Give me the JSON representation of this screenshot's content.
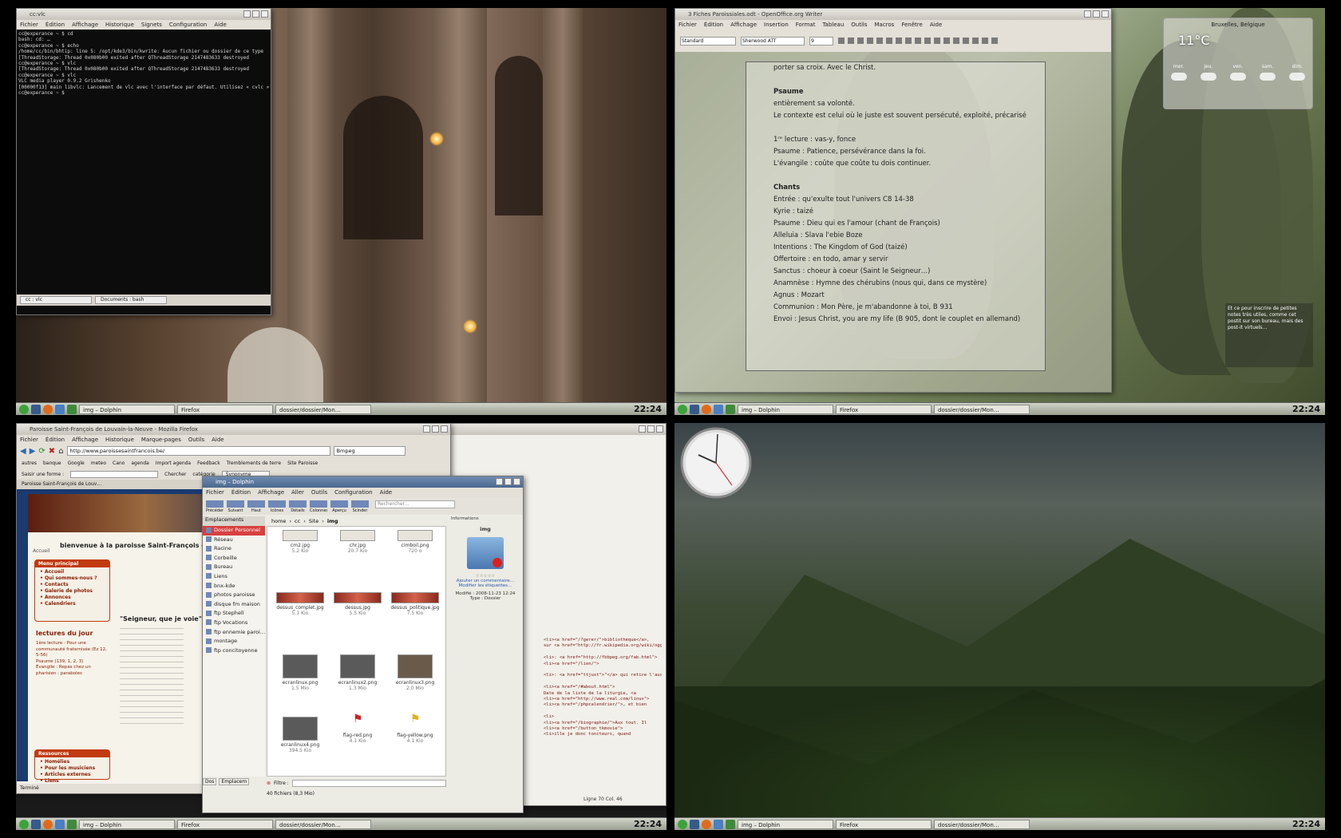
{
  "time": "22:24",
  "taskbar": {
    "tasks": [
      "img – Dolphin",
      "Firefox",
      "dossier/dossier/Mon…"
    ]
  },
  "q1": {
    "terminal": {
      "title": "cc:vlc",
      "menu": [
        "Fichier",
        "Édition",
        "Affichage",
        "Historique",
        "Signets",
        "Configuration",
        "Aide"
      ],
      "lines": [
        "cc@experance ~ $ cd",
        "bash: cd: …",
        "cc@experance ~ $ echo",
        "/home/cc/bin/bhtip: line 5: /opt/kde3/bin/kwrite: Aucun fichier ou dossier de ce type",
        "[ThreadStorage: Thread 0x080b00 exited after QThreadStorage 2147483633 destroyed",
        "cc@experance ~ $ vlc",
        "[ThreadStorage: Thread 0x080b00 exited after QThreadStorage 2147483633 destroyed",
        "cc@experance ~ $ vlc",
        "VLC media player 0.9.2 Grishenko",
        "[00000f13] main libvlc: Lancement de vlc avec l'interface par défaut. Utilisez « cvlc » pour démarrer VLC sans interface.",
        "cc@experance ~ $"
      ],
      "tabs": [
        "cc : vlc",
        "Documents : bash"
      ]
    }
  },
  "q2": {
    "writer": {
      "title": "3 Fiches Paroissiales.odt - OpenOffice.org Writer",
      "menu": [
        "Fichier",
        "Édition",
        "Affichage",
        "Insertion",
        "Format",
        "Tableau",
        "Outils",
        "Macros",
        "Fenêtre",
        "Aide"
      ],
      "style_select": "Standard",
      "font_select": "Sherwood ATT",
      "size_select": "9",
      "lines": [
        {
          "text": "porter sa croix. Avec le Christ.",
          "bold": false
        },
        {
          "text": "",
          "bold": false
        },
        {
          "text": "Psaume",
          "bold": true
        },
        {
          "text": "entièrement sa volonté.",
          "bold": false
        },
        {
          "text": "Le contexte est celui où le juste est souvent persécuté, exploité, précarisé",
          "bold": false
        },
        {
          "text": "",
          "bold": false
        },
        {
          "text": "1ʳᵉ lecture : vas-y, fonce",
          "bold": false
        },
        {
          "text": "Psaume : Patience, persévérance dans la foi.",
          "bold": false
        },
        {
          "text": "L'évangile : coûte que coûte tu dois continuer.",
          "bold": false
        },
        {
          "text": "",
          "bold": false
        },
        {
          "text": "Chants",
          "bold": true
        },
        {
          "text": "Entrée : qu'exulte tout l'univers C8 14-38",
          "bold": false
        },
        {
          "text": "Kyrie : taizé",
          "bold": false
        },
        {
          "text": "Psaume : Dieu qui es l'amour (chant de François)",
          "bold": false
        },
        {
          "text": "Alleluia : Slava l'ebie Boze",
          "bold": false
        },
        {
          "text": "Intentions : The Kingdom of God (taizé)",
          "bold": false
        },
        {
          "text": "Offertoire : en todo, amar y servir",
          "bold": false
        },
        {
          "text": "Sanctus : choeur à coeur (Saint le Seigneur…)",
          "bold": false
        },
        {
          "text": "Anamnèse : Hymne des chérubins (nous qui, dans ce mystère)",
          "bold": false
        },
        {
          "text": "Agnus : Mozart",
          "bold": false
        },
        {
          "text": "Communion : Mon Père, je m'abandonne à toi, B 931",
          "bold": false
        },
        {
          "text": "Envoi : Jesus Christ, you are my life (B 905, dont le couplet en allemand)",
          "bold": false
        }
      ]
    },
    "weather": {
      "city": "Bruxelles, Belgique",
      "temp": "11°C",
      "days": [
        "mer.",
        "jeu.",
        "ven.",
        "sam.",
        "dim."
      ]
    },
    "note": "Et ce pour inscrire de petites notes très utiles, comme cet postit sur son bureau, mais des post-it virtuels…"
  },
  "q3": {
    "firefox": {
      "title": "Paroisse Saint-François de Louvain-la-Neuve - Mozilla Firefox",
      "menu": [
        "Fichier",
        "Édition",
        "Affichage",
        "Historique",
        "Marque-pages",
        "Outils",
        "Aide"
      ],
      "url": "http://www.paroissesaintfrancois.be/",
      "search": "Bmpeg",
      "bookmarks": [
        "autres",
        "banque",
        "Google",
        "meteo",
        "Cano",
        "agenda",
        "Import agenda",
        "Feedback",
        "Tremblements de terre",
        "Site Paroisse"
      ],
      "findbar": [
        "Saisir une forme :",
        "Chercher",
        "catégorie",
        "Synonyme"
      ],
      "tab": "Paroisse Saint-François de Louv…",
      "welcome": "bienvenue à la paroisse Saint-François de",
      "accueil": "Accueil",
      "menu_principal": {
        "title": "Menu principal",
        "items": [
          "Accueil",
          "Qui sommes-nous ?",
          "Contacts",
          "Galerie de photos",
          "Annonces",
          "Calendriers"
        ]
      },
      "lectures_title": "lectures du jour",
      "lectures": [
        "1ère lecture : Pour une communauté fraternisée (Ez 12, 5-56)",
        "Psaume (139, 1, 2, 3)",
        "Évangile : Repas chez un pharisien : paraboles"
      ],
      "seigneur": "\"Seigneur, que je voie\"",
      "ressources": {
        "title": "Ressources",
        "items": [
          "Homélies",
          "Pour les musiciens",
          "Articles externes",
          "Liens"
        ]
      },
      "status": "Terminé"
    },
    "dolphin": {
      "title": "img – Dolphin",
      "menu": [
        "Fichier",
        "Édition",
        "Affichage",
        "Aller",
        "Outils",
        "Configuration",
        "Aide"
      ],
      "toolbar": [
        "Précédent",
        "Suivant",
        "Haut",
        "Icônes",
        "Détails",
        "Colonnes",
        "Aperçu",
        "Scinder"
      ],
      "search_placeholder": "Rechercher...",
      "breadcrumb": [
        "home",
        "cc",
        "Site",
        "img"
      ],
      "places_title": "Emplacements",
      "places": [
        "Dossier Personnel",
        "Réseau",
        "Racine",
        "Corbeille",
        "Bureau",
        "Liens",
        "bnx-kde",
        "photos paroisse",
        "disque fm maison",
        "ftp Stephell",
        "ftp Vocations",
        "ftp ennemie paroi…",
        "montage",
        "ftp concitoyenne"
      ],
      "info_title": "Informations",
      "info_name": "img",
      "info_rating": "☆☆☆☆☆",
      "info_comment": "Ajouter un commentaire…",
      "info_tags": "Modifier les étiquettes…",
      "info_modified": "Modifié : 2008-11-23 12:24",
      "info_type": "Type : Dossier",
      "files": [
        {
          "name": "cm2.jpg",
          "size": "5.2 Kio"
        },
        {
          "name": "chr.jpg",
          "size": "20.7 Kio"
        },
        {
          "name": "cimboil.png",
          "size": "720 o"
        },
        {
          "name": "dessus_complet.jpg",
          "size": "5.1 Kio"
        },
        {
          "name": "dessus.jpg",
          "size": "5.5 Kio"
        },
        {
          "name": "dessus_politique.jpg",
          "size": "7.5 Kio"
        },
        {
          "name": "ecranlinux.png",
          "size": "1.5 Mio"
        },
        {
          "name": "ecranlinux2.png",
          "size": "1.3 Mio"
        },
        {
          "name": "ecranlinux3.png",
          "size": "2.0 Mio"
        },
        {
          "name": "ecranlinux4.png",
          "size": "394.5 Kio"
        },
        {
          "name": "flag-red.png",
          "size": "4.1 Kio"
        },
        {
          "name": "flag-yellow.png",
          "size": "4.1 Kio"
        }
      ],
      "filter_label": "Filtre :",
      "tabs": [
        "Dos",
        "Emplacem"
      ],
      "status": "40 fichiers (8,3 Mio)"
    },
    "code_lines": [
      "<li><a href=\"/?gerer/\">bibliothèque</a>,",
      "sur <a href=\"http://fr.wikipedia.org/wiki/ogg\">ogg</a> difficile",
      "",
      "<li>: <a href=\"http://fbbpeg.org/fab.html\">",
      "<li><a href=\"/lien/\">",
      "",
      "<li>: <a href=\"ttjust\">\"</a> qui retire l'aussi le son",
      "",
      "<li><a href=\"/#about.html\">",
      "Date de la liste de la liturgie, <a",
      "<li><a href=\"http://www.real.com/linux\">",
      "<li><a href=\"/phpcalendrier/\">, et bien",
      "",
      "<li>",
      "<li><a href=\"/biographie/\">Aux tout. Il",
      "<li><a href=\"/button_tkmovie\">",
      "<li>ille je donc toncteurs, quand"
    ],
    "code_status": "Ligne 70 Col. 46"
  }
}
